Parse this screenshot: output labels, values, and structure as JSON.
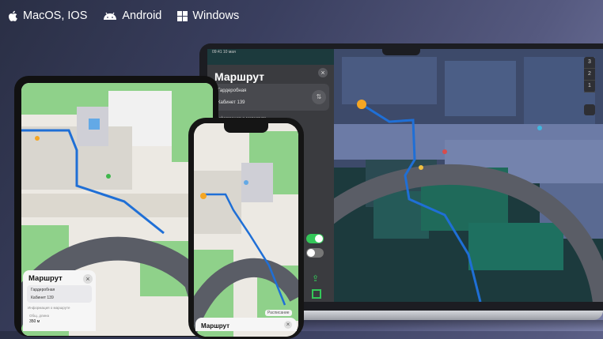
{
  "platforms": [
    {
      "icon": "apple-icon",
      "label": "MacOS, IOS"
    },
    {
      "icon": "android-icon",
      "label": "Android"
    },
    {
      "icon": "windows-icon",
      "label": "Windows"
    }
  ],
  "laptop": {
    "status_left": "09:41 10 мая",
    "route_panel": {
      "title": "Маршрут",
      "from": "Гардеробная",
      "to": "Кабинет 139",
      "info_label": "Информация о маршруте"
    },
    "floors": [
      "3",
      "2",
      "1"
    ]
  },
  "tablet": {
    "route_panel": {
      "title": "Маршрут",
      "from": "Гардеробная",
      "to": "Кабинет 139",
      "info_label": "Информация о маршруте",
      "distance_label": "Общ. длина",
      "distance_value": "350 м"
    }
  },
  "phone": {
    "route_panel": {
      "title": "Маршрут"
    },
    "floor_chip": "Расписание"
  },
  "colors": {
    "route": "#1f6fd6",
    "toggle_on": "#34c759",
    "map_dark": "#1c3a3d",
    "map_light": "#e8e6e1",
    "grass": "#8fd18a"
  }
}
